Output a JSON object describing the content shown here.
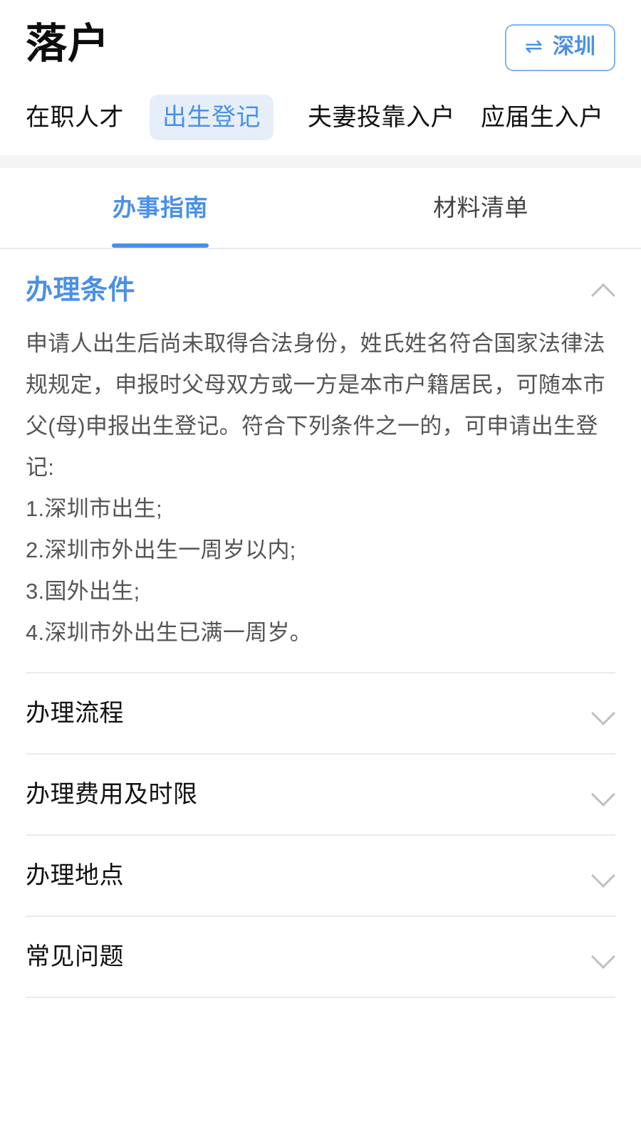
{
  "header": {
    "title": "落户",
    "city_switcher": {
      "icon": "swap-arrows-icon",
      "icon_glyph": "⇌",
      "city": "深圳"
    }
  },
  "category_tabs": [
    {
      "label": "在职人才",
      "active": false
    },
    {
      "label": "出生登记",
      "active": true
    },
    {
      "label": "夫妻投靠入户",
      "active": false
    },
    {
      "label": "应届生入户",
      "active": false
    }
  ],
  "sub_tabs": [
    {
      "label": "办事指南",
      "active": true
    },
    {
      "label": "材料清单",
      "active": false
    }
  ],
  "expanded_section": {
    "title": "办理条件",
    "toggle_icon": "chevron-up-icon",
    "paragraph": "申请人出生后尚未取得合法身份，姓氏姓名符合国家法律法规规定，申报时父母双方或一方是本市户籍居民，可随本市父(母)申报出生登记。符合下列条件之一的，可申请出生登记:",
    "items": [
      "1.深圳市出生;",
      "2.深圳市外出生一周岁以内;",
      "3.国外出生;",
      "4.深圳市外出生已满一周岁。"
    ]
  },
  "collapsed_sections": [
    {
      "label": "办理流程",
      "toggle_icon": "chevron-down-icon"
    },
    {
      "label": "办理费用及时限",
      "toggle_icon": "chevron-down-icon"
    },
    {
      "label": "办理地点",
      "toggle_icon": "chevron-down-icon"
    },
    {
      "label": "常见问题",
      "toggle_icon": "chevron-down-icon"
    }
  ],
  "colors": {
    "accent_blue": "#4a90e8",
    "pill_background": "#e6eff9",
    "text_primary": "#111111",
    "text_body": "#555555",
    "divider": "#ebebeb",
    "band": "#f3f4f5"
  }
}
